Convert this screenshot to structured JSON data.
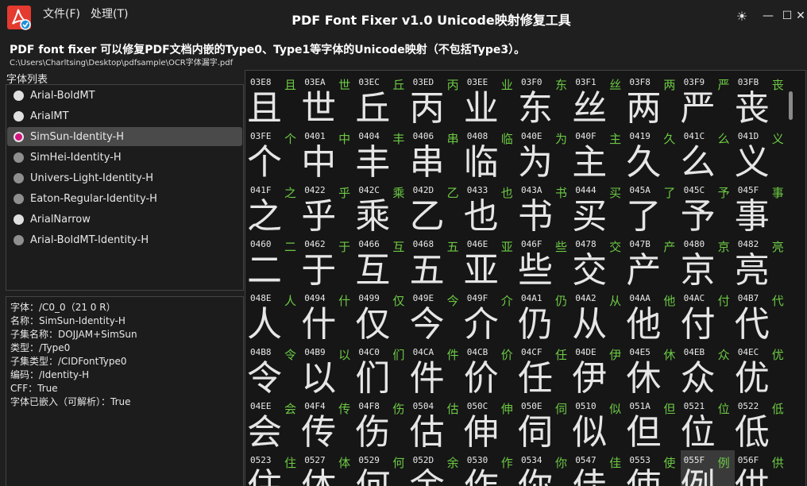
{
  "window": {
    "title": "PDF Font Fixer v1.0  Unicode映射修复工具"
  },
  "menu": {
    "file": "文件(F)",
    "process": "处理(T)"
  },
  "controls": {
    "theme": "☀",
    "minimize": "—",
    "maximize": "☐",
    "close": "✕"
  },
  "header": {
    "description": "PDF font fixer 可以修复PDF文档内嵌的Type0、Type1等字体的Unicode映射（不包括Type3）。",
    "path": "C:\\Users\\Charltsing\\Desktop\\pdfsample\\OCR字体漏字.pdf"
  },
  "font_list": {
    "label": "字体列表",
    "items": [
      {
        "name": "Arial-BoldMT",
        "dot": "white"
      },
      {
        "name": "ArialMT",
        "dot": "white"
      },
      {
        "name": "SimSun-Identity-H",
        "dot": "selected"
      },
      {
        "name": "SimHei-Identity-H",
        "dot": "gray"
      },
      {
        "name": "Univers-Light-Identity-H",
        "dot": "gray"
      },
      {
        "name": "Eaton-Regular-Identity-H",
        "dot": "gray"
      },
      {
        "name": "ArialNarrow",
        "dot": "white"
      },
      {
        "name": "Arial-BoldMT-Identity-H",
        "dot": "gray"
      }
    ]
  },
  "font_info": [
    "字体：/C0_0（21 0 R）",
    "名称：SimSun-Identity-H",
    "子集名称：DOJJAM+SimSun",
    "类型：/Type0",
    "子集类型：/CIDFontType0",
    "编码：/Identity-H",
    "CFF：True",
    "字体已嵌入（可解析）：True"
  ],
  "glyphs": [
    {
      "code": "03E8",
      "ch": "且"
    },
    {
      "code": "03EA",
      "ch": "世"
    },
    {
      "code": "03EC",
      "ch": "丘"
    },
    {
      "code": "03ED",
      "ch": "丙"
    },
    {
      "code": "03EE",
      "ch": "业"
    },
    {
      "code": "03F0",
      "ch": "东"
    },
    {
      "code": "03F1",
      "ch": "丝"
    },
    {
      "code": "03F8",
      "ch": "两"
    },
    {
      "code": "03F9",
      "ch": "严"
    },
    {
      "code": "03FB",
      "ch": "丧"
    },
    {
      "code": "03FE",
      "ch": "个"
    },
    {
      "code": "0401",
      "ch": "中"
    },
    {
      "code": "0404",
      "ch": "丰"
    },
    {
      "code": "0406",
      "ch": "串"
    },
    {
      "code": "0408",
      "ch": "临"
    },
    {
      "code": "040E",
      "ch": "为"
    },
    {
      "code": "040F",
      "ch": "主"
    },
    {
      "code": "0419",
      "ch": "久"
    },
    {
      "code": "041C",
      "ch": "么"
    },
    {
      "code": "041D",
      "ch": "义"
    },
    {
      "code": "041F",
      "ch": "之"
    },
    {
      "code": "0422",
      "ch": "乎"
    },
    {
      "code": "042C",
      "ch": "乘"
    },
    {
      "code": "042D",
      "ch": "乙"
    },
    {
      "code": "0433",
      "ch": "也"
    },
    {
      "code": "043A",
      "ch": "书"
    },
    {
      "code": "0444",
      "ch": "买"
    },
    {
      "code": "045A",
      "ch": "了"
    },
    {
      "code": "045C",
      "ch": "予"
    },
    {
      "code": "045F",
      "ch": "事"
    },
    {
      "code": "0460",
      "ch": "二"
    },
    {
      "code": "0462",
      "ch": "于"
    },
    {
      "code": "0466",
      "ch": "互"
    },
    {
      "code": "0468",
      "ch": "五"
    },
    {
      "code": "046E",
      "ch": "亚"
    },
    {
      "code": "046F",
      "ch": "些"
    },
    {
      "code": "0478",
      "ch": "交"
    },
    {
      "code": "047B",
      "ch": "产"
    },
    {
      "code": "0480",
      "ch": "京"
    },
    {
      "code": "0482",
      "ch": "亮"
    },
    {
      "code": "048E",
      "ch": "人"
    },
    {
      "code": "0494",
      "ch": "什"
    },
    {
      "code": "0499",
      "ch": "仅"
    },
    {
      "code": "049E",
      "ch": "今"
    },
    {
      "code": "049F",
      "ch": "介"
    },
    {
      "code": "04A1",
      "ch": "仍"
    },
    {
      "code": "04A2",
      "ch": "从"
    },
    {
      "code": "04AA",
      "ch": "他"
    },
    {
      "code": "04AC",
      "ch": "付"
    },
    {
      "code": "04B7",
      "ch": "代"
    },
    {
      "code": "04B8",
      "ch": "令"
    },
    {
      "code": "04B9",
      "ch": "以"
    },
    {
      "code": "04C0",
      "ch": "们"
    },
    {
      "code": "04CA",
      "ch": "件"
    },
    {
      "code": "04CB",
      "ch": "价"
    },
    {
      "code": "04CF",
      "ch": "任"
    },
    {
      "code": "04DE",
      "ch": "伊"
    },
    {
      "code": "04E5",
      "ch": "休"
    },
    {
      "code": "04EB",
      "ch": "众"
    },
    {
      "code": "04EC",
      "ch": "优"
    },
    {
      "code": "04EE",
      "ch": "会"
    },
    {
      "code": "04F4",
      "ch": "传"
    },
    {
      "code": "04F8",
      "ch": "伤"
    },
    {
      "code": "0504",
      "ch": "估"
    },
    {
      "code": "050C",
      "ch": "伸"
    },
    {
      "code": "050E",
      "ch": "伺"
    },
    {
      "code": "0510",
      "ch": "似"
    },
    {
      "code": "051A",
      "ch": "但"
    },
    {
      "code": "0521",
      "ch": "位"
    },
    {
      "code": "0522",
      "ch": "低"
    },
    {
      "code": "0523",
      "ch": "住"
    },
    {
      "code": "0527",
      "ch": "体"
    },
    {
      "code": "0529",
      "ch": "何"
    },
    {
      "code": "052D",
      "ch": "余"
    },
    {
      "code": "0530",
      "ch": "作"
    },
    {
      "code": "0534",
      "ch": "你"
    },
    {
      "code": "0547",
      "ch": "佳"
    },
    {
      "code": "0553",
      "ch": "使"
    },
    {
      "code": "055F",
      "ch": "例"
    },
    {
      "code": "056F",
      "ch": "供"
    }
  ],
  "highlighted_code": "055F"
}
